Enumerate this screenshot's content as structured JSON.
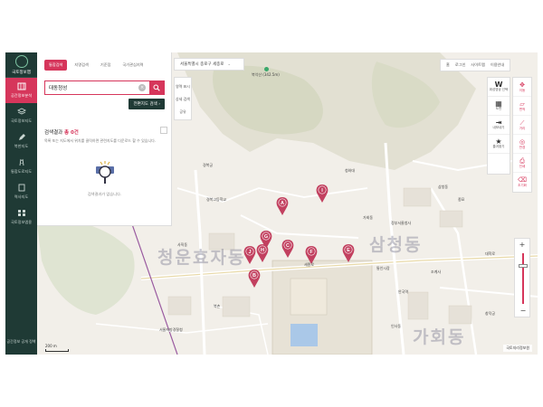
{
  "rail": {
    "logo": "국토정보맵",
    "items": [
      {
        "label": "공간정보분석"
      },
      {
        "label": "국토정보지도"
      },
      {
        "label": "북한지도"
      },
      {
        "label": "통합도로지도"
      },
      {
        "label": "역사지도"
      },
      {
        "label": "국토정보앱용"
      }
    ],
    "bottom": "공간정보 공개 정책"
  },
  "search": {
    "tabs": [
      "통합검색",
      "지명검색",
      "기준점",
      "국가관심지역"
    ],
    "query": "대동청성",
    "clear_icon": "clear-icon",
    "advanced_label": "전편지도 검색"
  },
  "results": {
    "title": "검색결과",
    "count_label": "총 0건",
    "description": "목록 또는 지도에서 위치를 클릭하면 관련지도를 다운로드 할 수 있습니다.",
    "empty_message": "검색결과가 없습니다."
  },
  "location": "서울특별시 종로구 세종로",
  "minimap": [
    "영역 표시",
    "상세 검색",
    "공유"
  ],
  "topmenu": [
    "홈",
    "로그인",
    "사이트맵",
    "이용안내"
  ],
  "tools": [
    {
      "icon": "W",
      "label": "위성영상 선택"
    },
    {
      "icon": "▦",
      "label": "도면"
    },
    {
      "icon": "⇥",
      "label": "내보내기"
    },
    {
      "icon": "★",
      "label": "즐겨찾기"
    },
    {
      "icon": "",
      "label": ""
    }
  ],
  "maptools": [
    "이동",
    "면적",
    "거리",
    "반경",
    "인쇄",
    "초기화"
  ],
  "markers": [
    "A",
    "I",
    "G",
    "C",
    "F",
    "E",
    "J",
    "H",
    "B"
  ],
  "map_labels": {
    "sejong": "세종로",
    "gyeongbokgung": "경복궁",
    "cheongwadae": "청와대",
    "mountain": "북악산 (342.5m)",
    "chuiwon": "정부서울청사",
    "changdeok": "창덕궁",
    "jongmyo": "종묘",
    "daehakro": "대학로",
    "gahoe": "가회동",
    "anguk": "안국역",
    "jogyesa": "조계사",
    "insadong": "인사동",
    "bukchon": "북촌",
    "samcheong": "삼청동",
    "sajik": "사직동",
    "tongin": "통인시장",
    "seoulyeok": "서울지방경찰청",
    "junior": "경복고등학교"
  },
  "districts": [
    "청운효자동",
    "삼청동",
    "가회동"
  ],
  "scale_label": "200 m",
  "credit": "국토지리정보원",
  "colors": {
    "accent": "#d6365b",
    "rail": "#1f3a35"
  }
}
